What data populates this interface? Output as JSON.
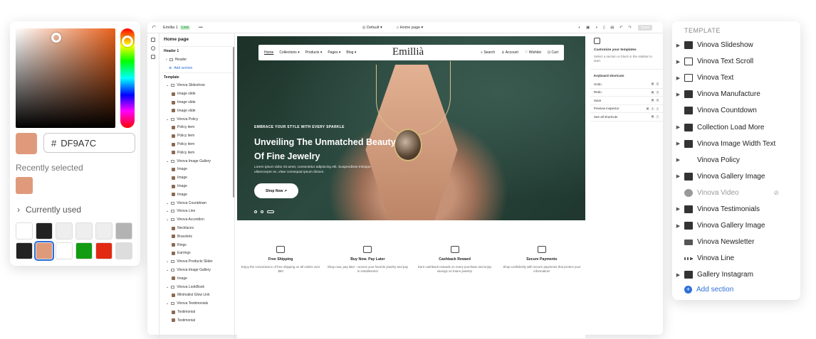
{
  "picker": {
    "hex_prefix": "#",
    "hex_value": "DF9A7C",
    "recently_selected_label": "Recently selected",
    "currently_used_label": "Currently used",
    "swatches": [
      "#ffffff",
      "#222222",
      "#eeeeee",
      "#eeeeee",
      "#eeeeee",
      "#b3b3b3",
      "#222222",
      "#df9a7c",
      "#ffffff",
      "#129c12",
      "#e22a12",
      "#dddddd"
    ]
  },
  "topbar": {
    "store_name": "Emillia 1",
    "live_badge": "Live",
    "more": "•••",
    "theme": "Default",
    "page": "Home page",
    "save": "Save"
  },
  "left_panel": {
    "title": "Home page",
    "header_group": "Header 1",
    "header": "Header",
    "add_section": "Add section",
    "template_label": "Template",
    "tree": [
      {
        "d": 1,
        "t": "Vinova Slideshow"
      },
      {
        "d": 2,
        "t": "Image slide"
      },
      {
        "d": 2,
        "t": "Image slide"
      },
      {
        "d": 2,
        "t": "Image slide"
      },
      {
        "d": 1,
        "t": "Vinova Policy"
      },
      {
        "d": 2,
        "t": "Policy item"
      },
      {
        "d": 2,
        "t": "Policy item"
      },
      {
        "d": 2,
        "t": "Policy item"
      },
      {
        "d": 2,
        "t": "Policy item"
      },
      {
        "d": 1,
        "t": "Vinova Image Gallery"
      },
      {
        "d": 2,
        "t": "Image"
      },
      {
        "d": 2,
        "t": "Image"
      },
      {
        "d": 2,
        "t": "Image"
      },
      {
        "d": 2,
        "t": "Image"
      },
      {
        "d": 1,
        "t": "Vinova Countdown"
      },
      {
        "d": 1,
        "t": "Vinova Line"
      },
      {
        "d": 1,
        "t": "Vinova Accordion"
      },
      {
        "d": 2,
        "t": "Necklaces"
      },
      {
        "d": 2,
        "t": "Bracelets"
      },
      {
        "d": 2,
        "t": "Rings"
      },
      {
        "d": 2,
        "t": "Earrings"
      },
      {
        "d": 1,
        "t": "Vinova Products Slider"
      },
      {
        "d": 1,
        "t": "Vinova Image Gallery"
      },
      {
        "d": 2,
        "t": "Image"
      },
      {
        "d": 1,
        "t": "Vinova LookBook"
      },
      {
        "d": 2,
        "t": "Minimalist Glow Link"
      },
      {
        "d": 1,
        "t": "Vinova Testimonials"
      },
      {
        "d": 2,
        "t": "Testimonial"
      },
      {
        "d": 2,
        "t": "Testimonial"
      }
    ]
  },
  "preview": {
    "nav": [
      "Home",
      "Collections",
      "Products",
      "Pages",
      "Blog"
    ],
    "logo": "Emillià",
    "nav_right": [
      "Search",
      "Account",
      "Wishlist",
      "Cart"
    ],
    "tagline": "EMBRACE YOUR STYLE WITH EVERY SPARKLE",
    "title": "Unveiling The Unmatched Beauty Of Fine Jewelry",
    "description": "Lorem ipsum dolor sit amet, consectetur adipiscing elit. Suspendisse tristique ullamcorper ex, vitae consequat ipsum dictum.",
    "shop_button": "Shop Now ↗",
    "features": [
      {
        "title": "Free Shipping",
        "desc": "Enjoy the convenience of free shipping on all orders over $50"
      },
      {
        "title": "Buy Now. Pay Later",
        "desc": "Shop now, pay later - access your favorite jewelry and pay in installments!"
      },
      {
        "title": "Cashback Reward",
        "desc": "Earn cashback rewards on every purchase and enjoy savings on future jewelry!"
      },
      {
        "title": "Secure Payments",
        "desc": "Shop confidently with secure payments that protect your information!"
      }
    ]
  },
  "right_panel": {
    "title": "Customize your templates",
    "hint": "Select a section or block in the sidebar to start.",
    "shortcuts_label": "Keyboard shortcuts",
    "shortcuts": [
      {
        "label": "Undo",
        "keys": [
          "⌘",
          "Z"
        ]
      },
      {
        "label": "Redo",
        "keys": [
          "⌘",
          "Y"
        ]
      },
      {
        "label": "Save",
        "keys": [
          "⌘",
          "S"
        ]
      },
      {
        "label": "Preview inspector",
        "keys": [
          "⌘",
          "⇧",
          "I"
        ]
      },
      {
        "label": "See all shortcuts",
        "keys": [
          "⌘",
          "/"
        ]
      }
    ]
  },
  "template_panel": {
    "heading": "TEMPLATE",
    "items": [
      {
        "label": "Vinova Slideshow",
        "icon": "image-icon",
        "arrow": true
      },
      {
        "label": "Vinova Text Scroll",
        "icon": "text-icon",
        "arrow": true
      },
      {
        "label": "Vinova Text",
        "icon": "text-icon",
        "arrow": true
      },
      {
        "label": "Vinova Manufacture",
        "icon": "manufacture-icon",
        "arrow": true
      },
      {
        "label": "Vinova Countdown",
        "icon": "countdown-icon",
        "arrow": false
      },
      {
        "label": "Collection Load More",
        "icon": "tag-icon",
        "arrow": true
      },
      {
        "label": "Vinova Image Width Text",
        "icon": "image-icon",
        "arrow": true
      },
      {
        "label": "Vinova Policy",
        "icon": "policy-icon",
        "arrow": true
      },
      {
        "label": "Vinova Gallery Image",
        "icon": "gallery-icon",
        "arrow": true
      },
      {
        "label": "Vinova Video",
        "icon": "play-icon",
        "arrow": false,
        "hidden": true
      },
      {
        "label": "Vinova Testimonials",
        "icon": "quote-icon",
        "arrow": true
      },
      {
        "label": "Vinova Gallery Image",
        "icon": "gallery-icon",
        "arrow": true
      },
      {
        "label": "Vinova Newsletter",
        "icon": "mail-icon",
        "arrow": false
      },
      {
        "label": "Vinova Line",
        "icon": "line-icon",
        "arrow": false
      },
      {
        "label": "Gallery Instagram",
        "icon": "gallery-icon",
        "arrow": true
      }
    ],
    "add_section": "Add section"
  }
}
